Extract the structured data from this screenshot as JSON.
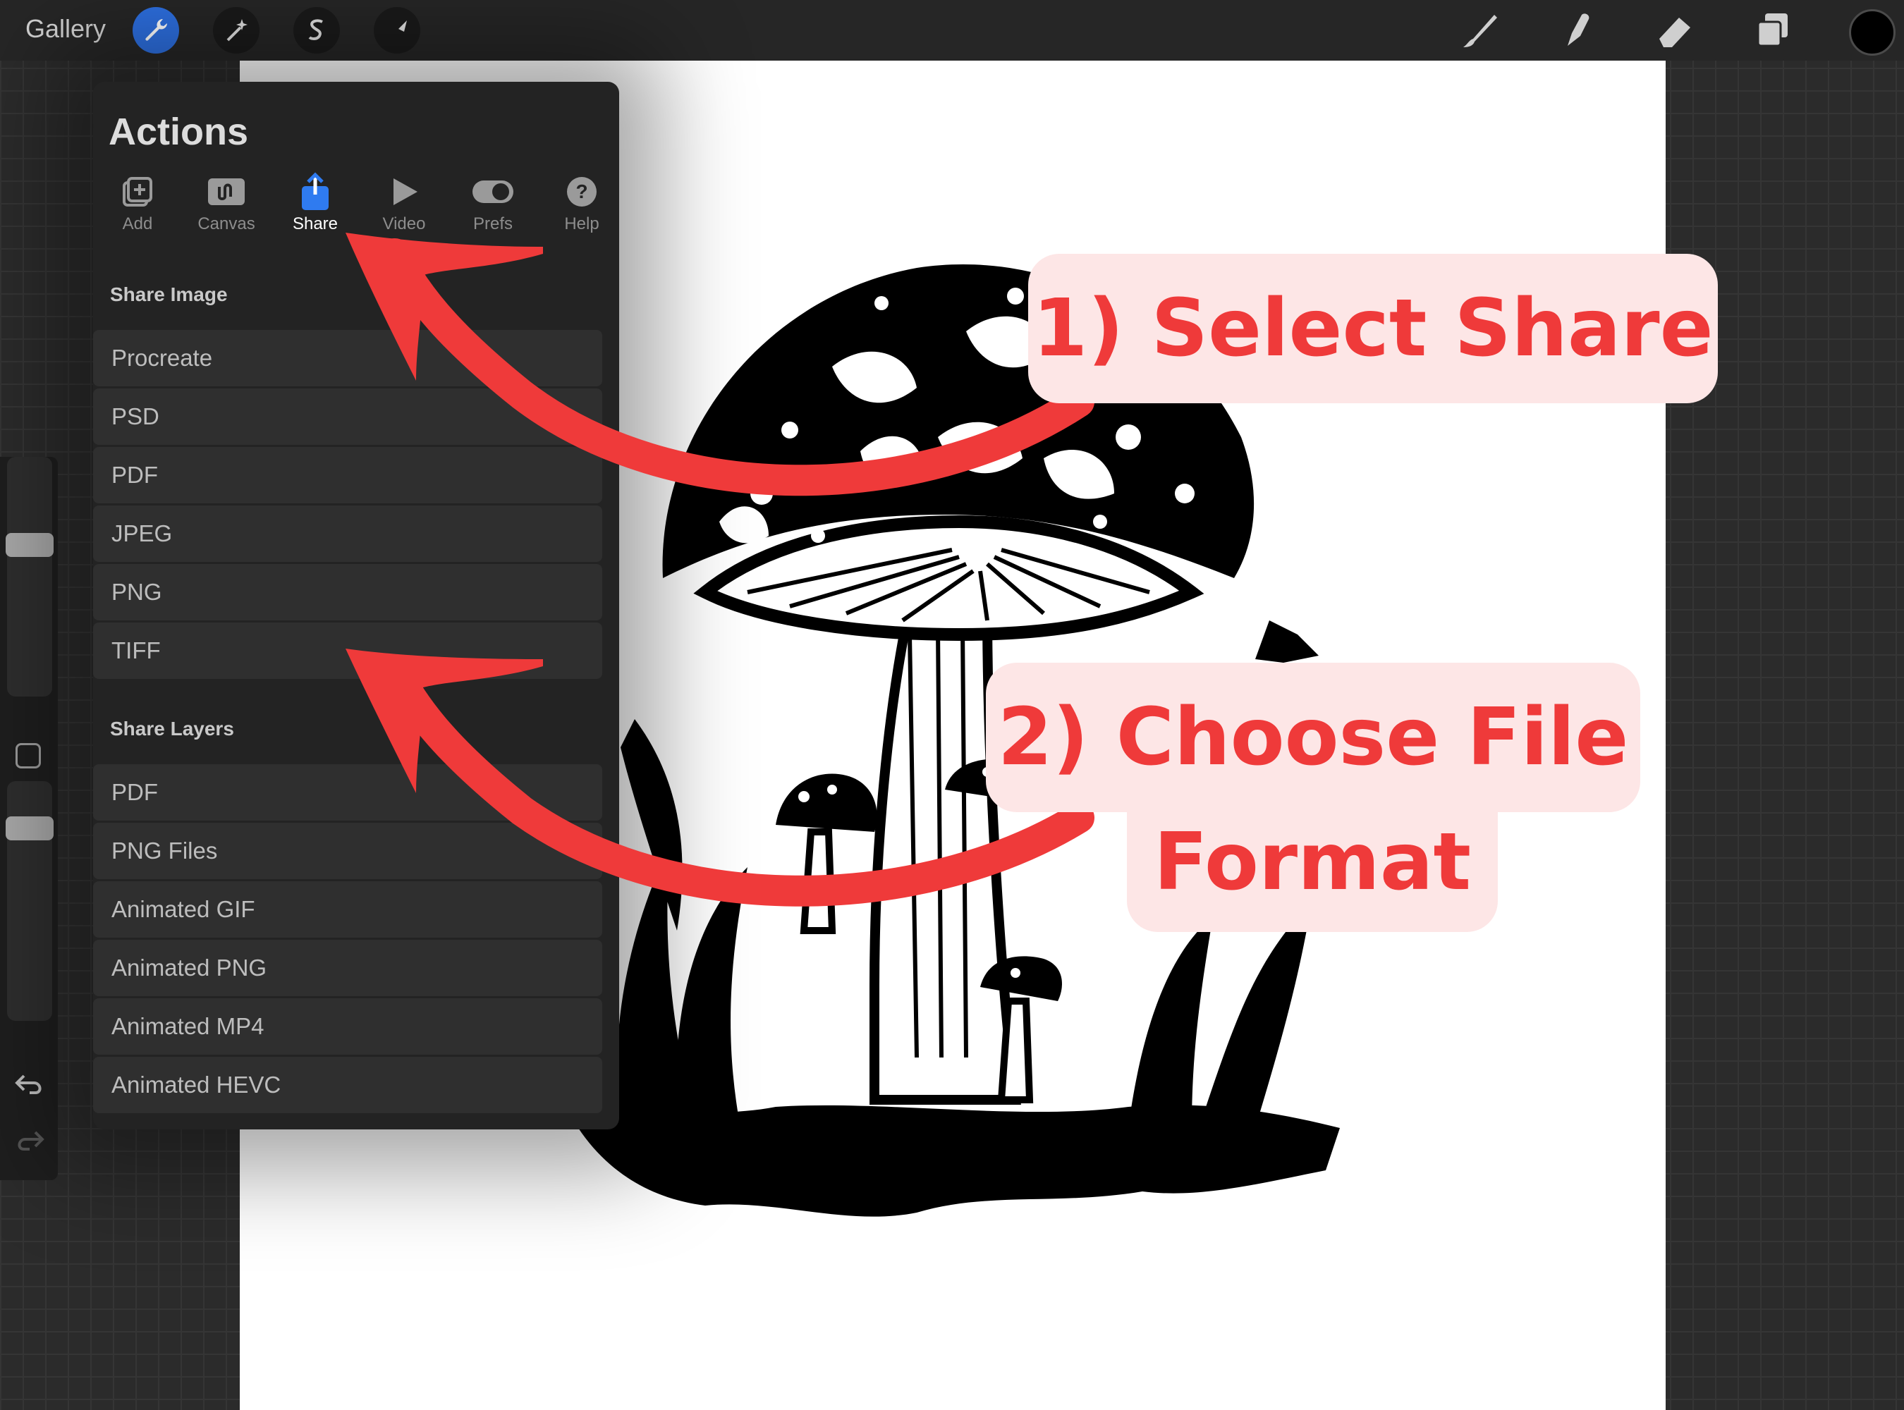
{
  "topbar": {
    "gallery_label": "Gallery",
    "left_tools": [
      "wrench-icon",
      "magic-wand-icon",
      "selection-icon",
      "transform-arrow-icon"
    ],
    "right_tools": [
      "brush-icon",
      "smudge-icon",
      "eraser-icon",
      "layers-icon",
      "color-icon"
    ],
    "active_color": "#000000",
    "accent": "#2d6fe0"
  },
  "panel": {
    "title": "Actions",
    "tabs": [
      {
        "label": "Add",
        "icon": "add-image-icon"
      },
      {
        "label": "Canvas",
        "icon": "canvas-icon"
      },
      {
        "label": "Share",
        "icon": "share-icon",
        "active": true
      },
      {
        "label": "Video",
        "icon": "play-icon"
      },
      {
        "label": "Prefs",
        "icon": "toggle-icon"
      },
      {
        "label": "Help",
        "icon": "help-icon"
      }
    ],
    "share_image": {
      "heading": "Share Image",
      "items": [
        "Procreate",
        "PSD",
        "PDF",
        "JPEG",
        "PNG",
        "TIFF"
      ]
    },
    "share_layers": {
      "heading": "Share Layers",
      "items": [
        "PDF",
        "PNG Files",
        "Animated GIF",
        "Animated PNG",
        "Animated MP4",
        "Animated HEVC"
      ]
    }
  },
  "annotations": {
    "step1": "1) Select Share",
    "step2_line1": "2) Choose File",
    "step2_line2": "Format",
    "arrow_color": "#ef3a3a"
  }
}
